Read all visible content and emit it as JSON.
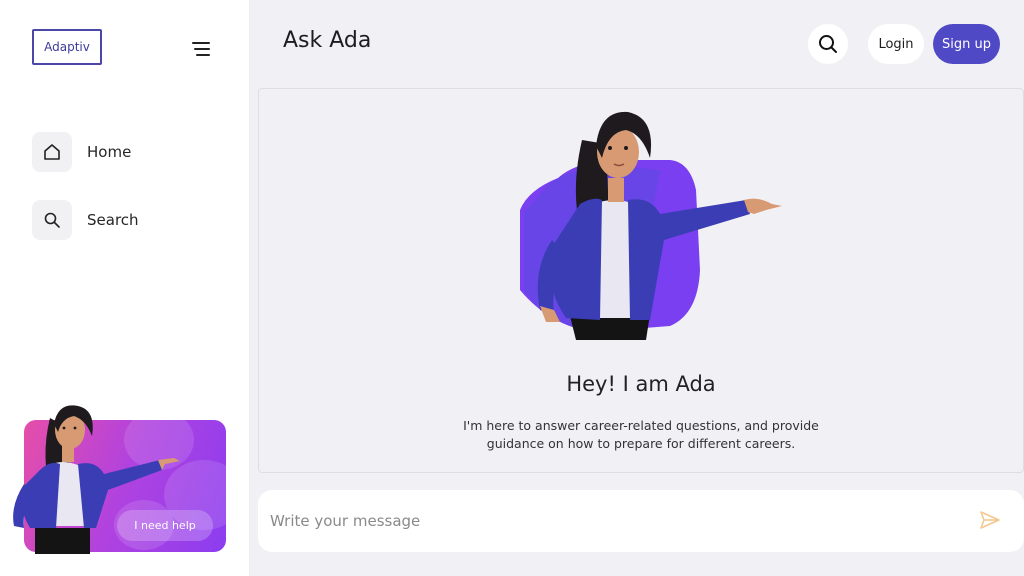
{
  "brand": {
    "logo_text": "Adaptiv"
  },
  "sidebar": {
    "items": [
      {
        "label": "Home",
        "icon": "home-icon"
      },
      {
        "label": "Search",
        "icon": "search-icon"
      }
    ],
    "help_card": {
      "button_label": "I need help"
    }
  },
  "header": {
    "title": "Ask Ada",
    "login_label": "Login",
    "signup_label": "Sign up"
  },
  "hero": {
    "greeting": "Hey! I am Ada",
    "description": "I'm here to answer career-related questions, and provide guidance on how to prepare for different careers."
  },
  "composer": {
    "placeholder": "Write your message"
  },
  "colors": {
    "accent": "#4f49c6",
    "hero_blob": "#7a3ff0",
    "jacket": "#3b3db5",
    "send_icon": "#f3c98e"
  }
}
